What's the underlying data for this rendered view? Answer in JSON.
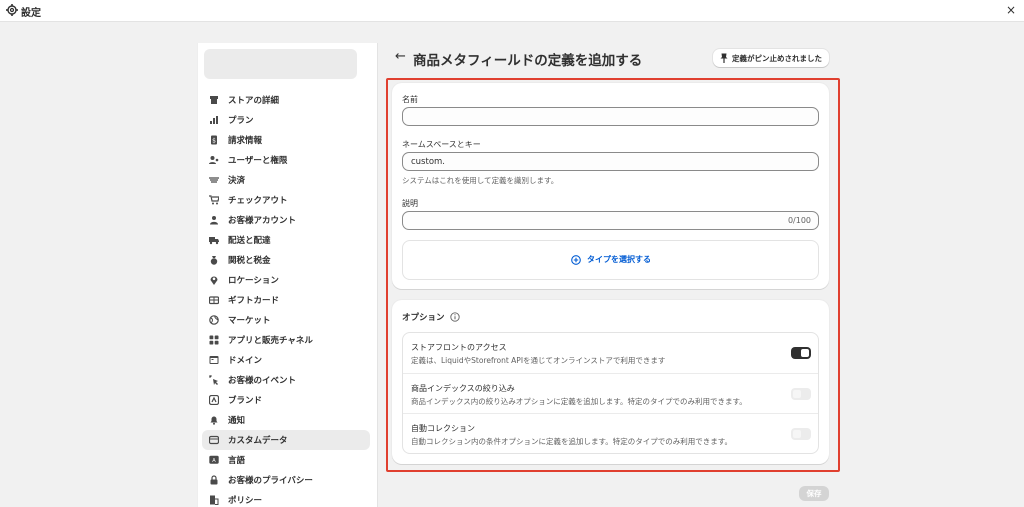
{
  "window": {
    "title": "設定",
    "close_glyph": "×"
  },
  "sidebar": {
    "items": [
      {
        "label": "ストアの詳細",
        "icon": "store-icon"
      },
      {
        "label": "プラン",
        "icon": "plan-icon"
      },
      {
        "label": "請求情報",
        "icon": "billing-icon"
      },
      {
        "label": "ユーザーと権限",
        "icon": "users-icon"
      },
      {
        "label": "決済",
        "icon": "payments-icon"
      },
      {
        "label": "チェックアウト",
        "icon": "cart-icon"
      },
      {
        "label": "お客様アカウント",
        "icon": "person-icon"
      },
      {
        "label": "配送と配達",
        "icon": "truck-icon"
      },
      {
        "label": "関税と税金",
        "icon": "tax-icon"
      },
      {
        "label": "ロケーション",
        "icon": "location-icon"
      },
      {
        "label": "ギフトカード",
        "icon": "gift-card-icon"
      },
      {
        "label": "マーケット",
        "icon": "globe-icon"
      },
      {
        "label": "アプリと販売チャネル",
        "icon": "apps-icon"
      },
      {
        "label": "ドメイン",
        "icon": "domain-icon"
      },
      {
        "label": "お客様のイベント",
        "icon": "cursor-icon"
      },
      {
        "label": "ブランド",
        "icon": "brand-icon"
      },
      {
        "label": "通知",
        "icon": "bell-icon"
      },
      {
        "label": "カスタムデータ",
        "icon": "database-icon",
        "active": true
      },
      {
        "label": "言語",
        "icon": "language-icon"
      },
      {
        "label": "お客様のプライバシー",
        "icon": "lock-icon"
      },
      {
        "label": "ポリシー",
        "icon": "policy-icon"
      }
    ]
  },
  "header": {
    "back_glyph": "←",
    "title": "商品メタフィールドの定義を追加する",
    "pin_button": "定義がピン止めされました"
  },
  "form": {
    "name_label": "名前",
    "name_value": "",
    "namespace_label": "ネームスペースとキー",
    "namespace_value": "custom.",
    "namespace_help": "システムはこれを使用して定義を識別します。",
    "description_label": "説明",
    "description_value": "",
    "description_count": "0/100",
    "select_type": "タイプを選択する"
  },
  "options": {
    "title": "オプション",
    "rows": [
      {
        "title": "ストアフロントのアクセス",
        "desc": "定義は、LiquidやStorefront APIを通じてオンラインストアで利用できます",
        "enabled": true
      },
      {
        "title": "商品インデックスの絞り込み",
        "desc": "商品インデックス内の絞り込みオプションに定義を追加します。特定のタイプでのみ利用できます。",
        "enabled": false
      },
      {
        "title": "自動コレクション",
        "desc": "自動コレクション内の条件オプションに定義を追加します。特定のタイプでのみ利用できます。",
        "enabled": false
      }
    ]
  },
  "footer": {
    "save_label": "保存"
  },
  "colors": {
    "accent": "#005bd3",
    "highlight": "#e0402f",
    "toggle_on": "#303030"
  }
}
